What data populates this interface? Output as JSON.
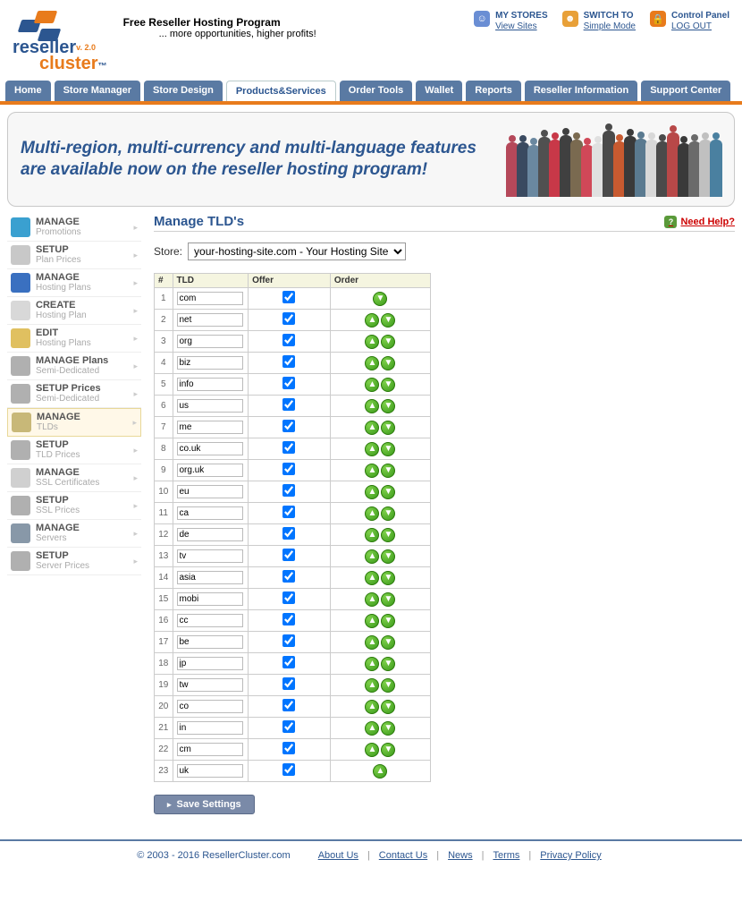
{
  "brand": {
    "line1": "reseller",
    "line2": "cluster",
    "tm": "™",
    "ver": "v. 2.0"
  },
  "tagline": {
    "title": "Free Reseller Hosting Program",
    "sub": "... more opportunities, higher profits!"
  },
  "header_links": [
    {
      "top": "MY STORES",
      "link": "View Sites",
      "color": "#6a8ed4",
      "glyph": "☺"
    },
    {
      "top": "SWITCH TO",
      "link": "Simple Mode",
      "color": "#e8a038",
      "glyph": "☻"
    },
    {
      "top": "Control Panel",
      "link": "LOG OUT",
      "color": "#e87b1c",
      "glyph": "🔒"
    }
  ],
  "nav": [
    "Home",
    "Store Manager",
    "Store Design",
    "Products&Services",
    "Order Tools",
    "Wallet",
    "Reports",
    "Reseller Information",
    "Support Center"
  ],
  "nav_active": "Products&Services",
  "promo": "Multi-region, multi-currency and multi-language features are available now on the reseller hosting program!",
  "sidebar": [
    {
      "t": "MANAGE",
      "s": "Promotions",
      "c": "#3aa0d0"
    },
    {
      "t": "SETUP",
      "s": "Plan Prices",
      "c": "#c8c8c8"
    },
    {
      "t": "MANAGE",
      "s": "Hosting Plans",
      "c": "#3a70c0"
    },
    {
      "t": "CREATE",
      "s": "Hosting Plan",
      "c": "#d8d8d8"
    },
    {
      "t": "EDIT",
      "s": "Hosting Plans",
      "c": "#e0c060"
    },
    {
      "t": "MANAGE Plans",
      "s": "Semi-Dedicated",
      "c": "#b0b0b0"
    },
    {
      "t": "SETUP Prices",
      "s": "Semi-Dedicated",
      "c": "#b0b0b0"
    },
    {
      "t": "MANAGE",
      "s": "TLDs",
      "c": "#c8b878",
      "active": true
    },
    {
      "t": "SETUP",
      "s": "TLD Prices",
      "c": "#b0b0b0"
    },
    {
      "t": "MANAGE",
      "s": "SSL Certificates",
      "c": "#d0d0d0"
    },
    {
      "t": "SETUP",
      "s": "SSL Prices",
      "c": "#b0b0b0"
    },
    {
      "t": "MANAGE",
      "s": "Servers",
      "c": "#8898a8"
    },
    {
      "t": "SETUP",
      "s": "Server Prices",
      "c": "#b0b0b0"
    }
  ],
  "page_title": "Manage TLD's",
  "need_help": "Need Help?",
  "store_label": "Store:",
  "store_options": [
    "your-hosting-site.com - Your Hosting Site"
  ],
  "table_headers": {
    "num": "#",
    "tld": "TLD",
    "offer": "Offer",
    "order": "Order"
  },
  "tlds": [
    {
      "n": 1,
      "v": "com",
      "up": false,
      "down": true
    },
    {
      "n": 2,
      "v": "net",
      "up": true,
      "down": true
    },
    {
      "n": 3,
      "v": "org",
      "up": true,
      "down": true
    },
    {
      "n": 4,
      "v": "biz",
      "up": true,
      "down": true
    },
    {
      "n": 5,
      "v": "info",
      "up": true,
      "down": true
    },
    {
      "n": 6,
      "v": "us",
      "up": true,
      "down": true
    },
    {
      "n": 7,
      "v": "me",
      "up": true,
      "down": true
    },
    {
      "n": 8,
      "v": "co.uk",
      "up": true,
      "down": true
    },
    {
      "n": 9,
      "v": "org.uk",
      "up": true,
      "down": true
    },
    {
      "n": 10,
      "v": "eu",
      "up": true,
      "down": true
    },
    {
      "n": 11,
      "v": "ca",
      "up": true,
      "down": true
    },
    {
      "n": 12,
      "v": "de",
      "up": true,
      "down": true
    },
    {
      "n": 13,
      "v": "tv",
      "up": true,
      "down": true
    },
    {
      "n": 14,
      "v": "asia",
      "up": true,
      "down": true
    },
    {
      "n": 15,
      "v": "mobi",
      "up": true,
      "down": true
    },
    {
      "n": 16,
      "v": "cc",
      "up": true,
      "down": true
    },
    {
      "n": 17,
      "v": "be",
      "up": true,
      "down": true
    },
    {
      "n": 18,
      "v": "jp",
      "up": true,
      "down": true
    },
    {
      "n": 19,
      "v": "tw",
      "up": true,
      "down": true
    },
    {
      "n": 20,
      "v": "co",
      "up": true,
      "down": true
    },
    {
      "n": 21,
      "v": "in",
      "up": true,
      "down": true
    },
    {
      "n": 22,
      "v": "cm",
      "up": true,
      "down": true
    },
    {
      "n": 23,
      "v": "uk",
      "up": true,
      "down": false
    }
  ],
  "save_label": "Save Settings",
  "footer": {
    "copy": "© 2003 - 2016 ResellerCluster.com",
    "links": [
      "About Us",
      "Contact Us",
      "News",
      "Terms",
      "Privacy Policy"
    ]
  },
  "people_colors": [
    "#b5485a",
    "#3a4a60",
    "#6a88a0",
    "#505050",
    "#c83848",
    "#404040",
    "#7a6a50",
    "#d04858",
    "#e0e0e0",
    "#4a4a4a",
    "#c85a30",
    "#3a3a3a",
    "#5a7a90",
    "#d8d8d8",
    "#4a4a4a",
    "#b84848",
    "#3a3a3a",
    "#6a6a6a",
    "#c0c0c0",
    "#4a80a0"
  ]
}
